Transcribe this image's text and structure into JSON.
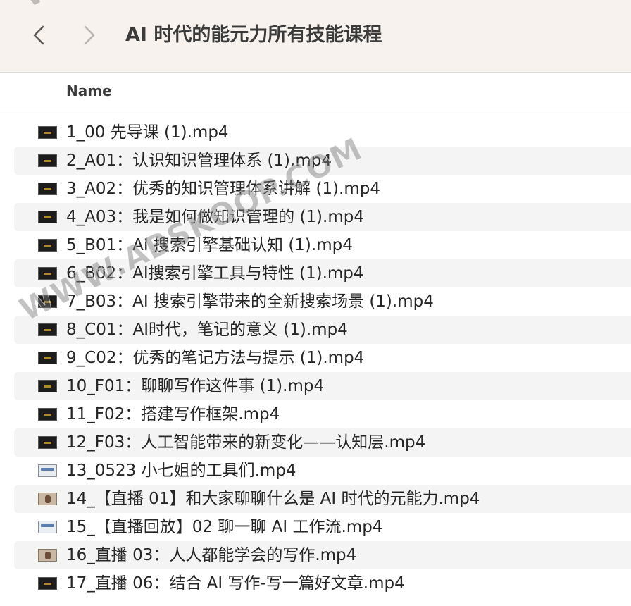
{
  "toolbar": {
    "title": "AI 时代的能元力所有技能课程",
    "back_icon": "chevron-left-icon",
    "forward_icon": "chevron-right-icon"
  },
  "header": {
    "name_column": "Name"
  },
  "files": [
    {
      "name": "1_00 先导课 (1).mp4",
      "thumb": "dark"
    },
    {
      "name": "2_A01：认识知识管理体系 (1).mp4",
      "thumb": "dark"
    },
    {
      "name": "3_A02：优秀的知识管理体系讲解 (1).mp4",
      "thumb": "dark"
    },
    {
      "name": "4_A03：我是如何做知识管理的 (1).mp4",
      "thumb": "dark"
    },
    {
      "name": "5_B01：AI 搜索引擎基础认知 (1).mp4",
      "thumb": "dark"
    },
    {
      "name": "6_B02：AI搜索引擎工具与特性 (1).mp4",
      "thumb": "dark"
    },
    {
      "name": "7_B03：AI 搜索引擎带来的全新搜索场景 (1).mp4",
      "thumb": "dark"
    },
    {
      "name": "8_C01：AI时代，笔记的意义 (1).mp4",
      "thumb": "dark"
    },
    {
      "name": "9_C02：优秀的笔记方法与提示 (1).mp4",
      "thumb": "dark"
    },
    {
      "name": "10_F01：聊聊写作这件事 (1).mp4",
      "thumb": "dark"
    },
    {
      "name": "11_F02：搭建写作框架.mp4",
      "thumb": "dark"
    },
    {
      "name": "12_F03：人工智能带来的新变化——认知层.mp4",
      "thumb": "dark"
    },
    {
      "name": "13_0523 小七姐的工具们.mp4",
      "thumb": "light"
    },
    {
      "name": "14_【直播 01】和大家聊聊什么是 AI 时代的元能力.mp4",
      "thumb": "photo"
    },
    {
      "name": "15_【直播回放】02 聊一聊 AI 工作流.mp4",
      "thumb": "light"
    },
    {
      "name": "16_直播 03：人人都能学会的写作.mp4",
      "thumb": "photo"
    },
    {
      "name": "17_直播 06：结合 AI 写作-写一篇好文章.mp4",
      "thumb": "dark"
    }
  ],
  "watermark": {
    "text": "WWW.ABSKOOP.COM",
    "top_text": "WWW"
  }
}
